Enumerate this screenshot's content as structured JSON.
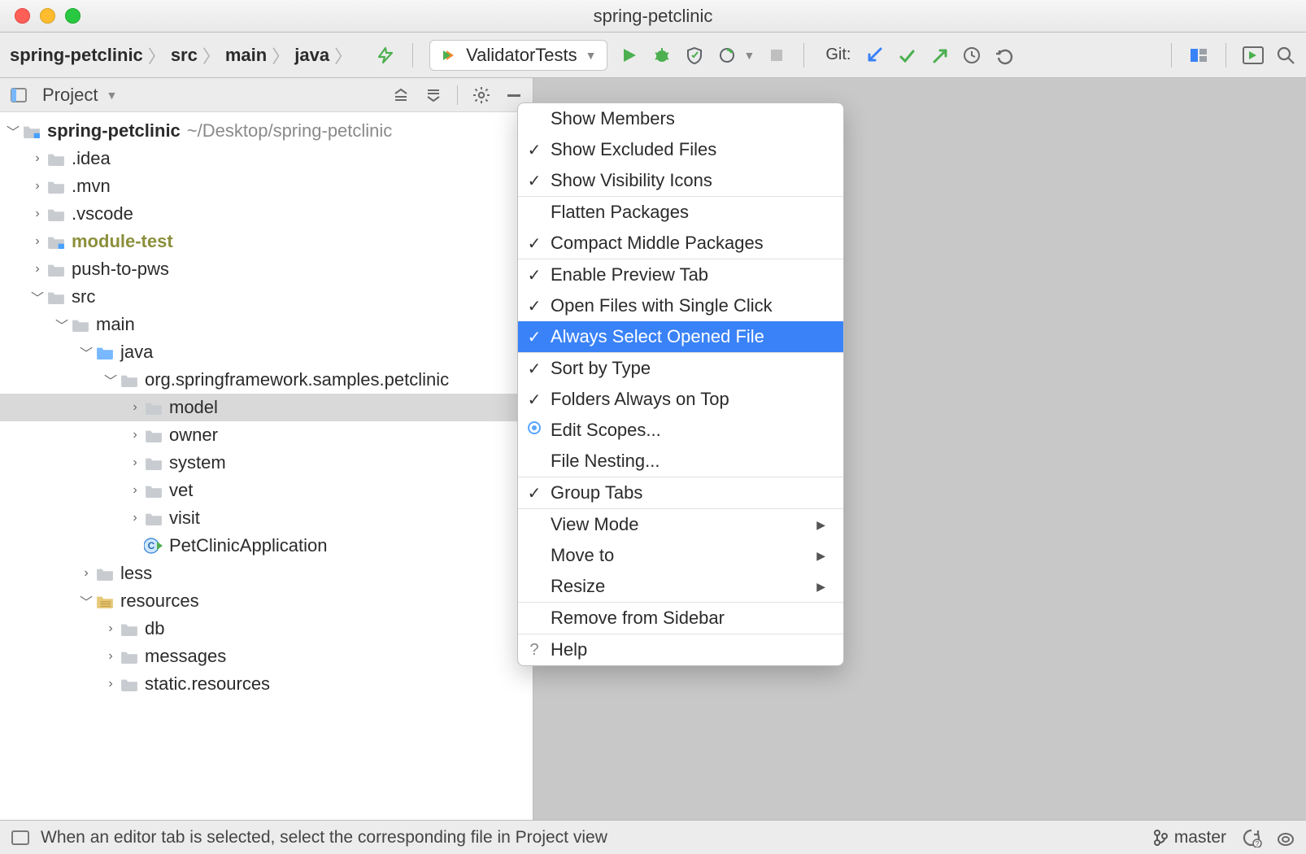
{
  "window": {
    "title": "spring-petclinic"
  },
  "breadcrumbs": [
    "spring-petclinic",
    "src",
    "main",
    "java"
  ],
  "run_config": {
    "label": "ValidatorTests"
  },
  "git": {
    "label": "Git:"
  },
  "panel": {
    "title": "Project"
  },
  "tree": {
    "root": {
      "name": "spring-petclinic",
      "path": "~/Desktop/spring-petclinic"
    },
    "idea": ".idea",
    "mvn": ".mvn",
    "vscode": ".vscode",
    "module_test": "module-test",
    "push_to_pws": "push-to-pws",
    "src": "src",
    "main": "main",
    "java": "java",
    "pkg": "org.springframework.samples.petclinic",
    "model": "model",
    "owner": "owner",
    "system": "system",
    "vet": "vet",
    "visit": "visit",
    "petclinic_app": "PetClinicApplication",
    "less": "less",
    "resources": "resources",
    "db": "db",
    "messages": "messages",
    "static_resources": "static.resources"
  },
  "menu": {
    "show_members": "Show Members",
    "show_excluded": "Show Excluded Files",
    "show_visibility": "Show Visibility Icons",
    "flatten": "Flatten Packages",
    "compact": "Compact Middle Packages",
    "preview_tab": "Enable Preview Tab",
    "single_click": "Open Files with Single Click",
    "always_select": "Always Select Opened File",
    "sort_type": "Sort by Type",
    "folders_top": "Folders Always on Top",
    "edit_scopes": "Edit Scopes...",
    "file_nesting": "File Nesting...",
    "group_tabs": "Group Tabs",
    "view_mode": "View Mode",
    "move_to": "Move to",
    "resize": "Resize",
    "remove_sidebar": "Remove from Sidebar",
    "help": "Help"
  },
  "status": {
    "hint": "When an editor tab is selected, select the corresponding file in Project view",
    "branch": "master"
  }
}
